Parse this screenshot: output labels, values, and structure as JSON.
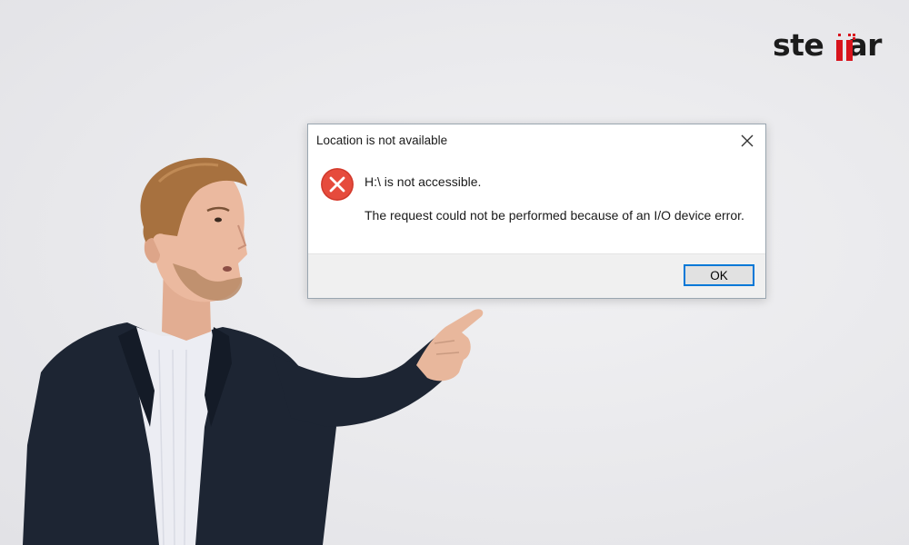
{
  "brand": {
    "logo_text_before": "ste",
    "logo_text_after": "ar",
    "accent_color": "#d8141d"
  },
  "dialog": {
    "title": "Location is not available",
    "close_icon": "close-icon",
    "status_icon": "error-icon",
    "status_color": "#e64b3c",
    "message": "H:\\ is not accessible.",
    "detail": "The request could not be performed because of an I/O device error.",
    "ok_label": "OK"
  }
}
